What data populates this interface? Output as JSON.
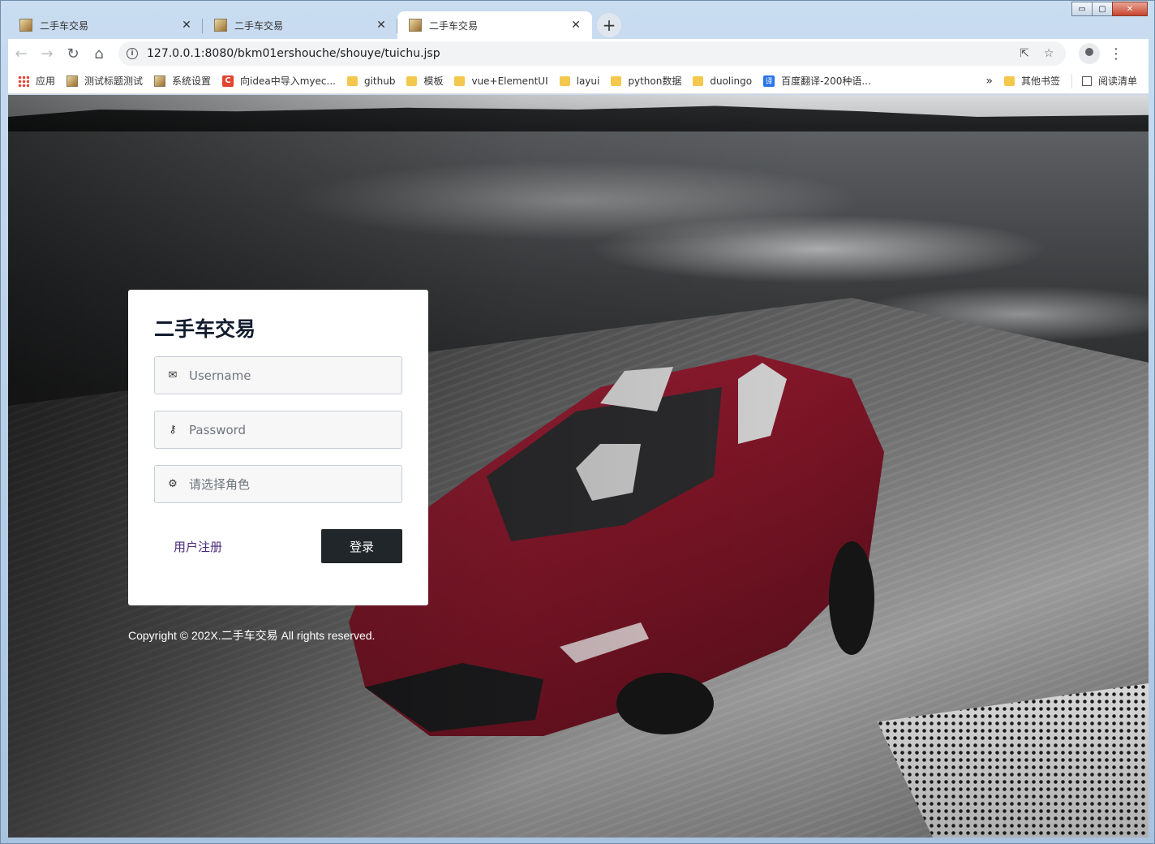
{
  "window": {
    "controls": {
      "minimize": "▭",
      "maximize": "▢",
      "close": "✕"
    }
  },
  "tabs": [
    {
      "title": "二手车交易",
      "close": "✕",
      "active": false
    },
    {
      "title": "二手车交易",
      "close": "✕",
      "active": false
    },
    {
      "title": "二手车交易",
      "close": "✕",
      "active": true
    }
  ],
  "new_tab_label": "+",
  "toolbar": {
    "back": "←",
    "forward": "→",
    "reload": "↻",
    "home": "⌂",
    "info": "i",
    "url": "127.0.0.1:8080/bkm01ershouche/shouye/tuichu.jsp",
    "share": "⇱",
    "star": "☆",
    "menu": "⋮"
  },
  "bookmarks": {
    "items": [
      {
        "label": "应用",
        "icon": "apps-grid-icon"
      },
      {
        "label": "测试标题测试",
        "icon": "app-favicon"
      },
      {
        "label": "系统设置",
        "icon": "app-favicon"
      },
      {
        "label": "向idea中导入myec...",
        "icon": "c-icon"
      },
      {
        "label": "github",
        "icon": "folder-icon"
      },
      {
        "label": "模板",
        "icon": "folder-icon"
      },
      {
        "label": "vue+ElementUI",
        "icon": "folder-icon"
      },
      {
        "label": "layui",
        "icon": "folder-icon"
      },
      {
        "label": "python数据",
        "icon": "folder-icon"
      },
      {
        "label": "duolingo",
        "icon": "folder-icon"
      },
      {
        "label": "百度翻译-200种语...",
        "icon": "translate-icon"
      }
    ],
    "more": "»",
    "other": "其他书签",
    "reading_list": "阅读清单",
    "c_glyph": "C",
    "translate_glyph": "译"
  },
  "login": {
    "title": "二手车交易",
    "username_placeholder": "Username",
    "password_placeholder": "Password",
    "role_placeholder": "请选择角色",
    "register_label": "用户注册",
    "submit_label": "登录"
  },
  "icons": {
    "username": "✉",
    "password": "⚷",
    "role": "⚙"
  },
  "footer": {
    "copyright": "Copyright © 202X.二手车交易 All rights reserved."
  },
  "colors": {
    "card_bg": "#ffffff",
    "title": "#111c2e",
    "button_bg": "#21262b",
    "link": "#4b2a7a"
  }
}
